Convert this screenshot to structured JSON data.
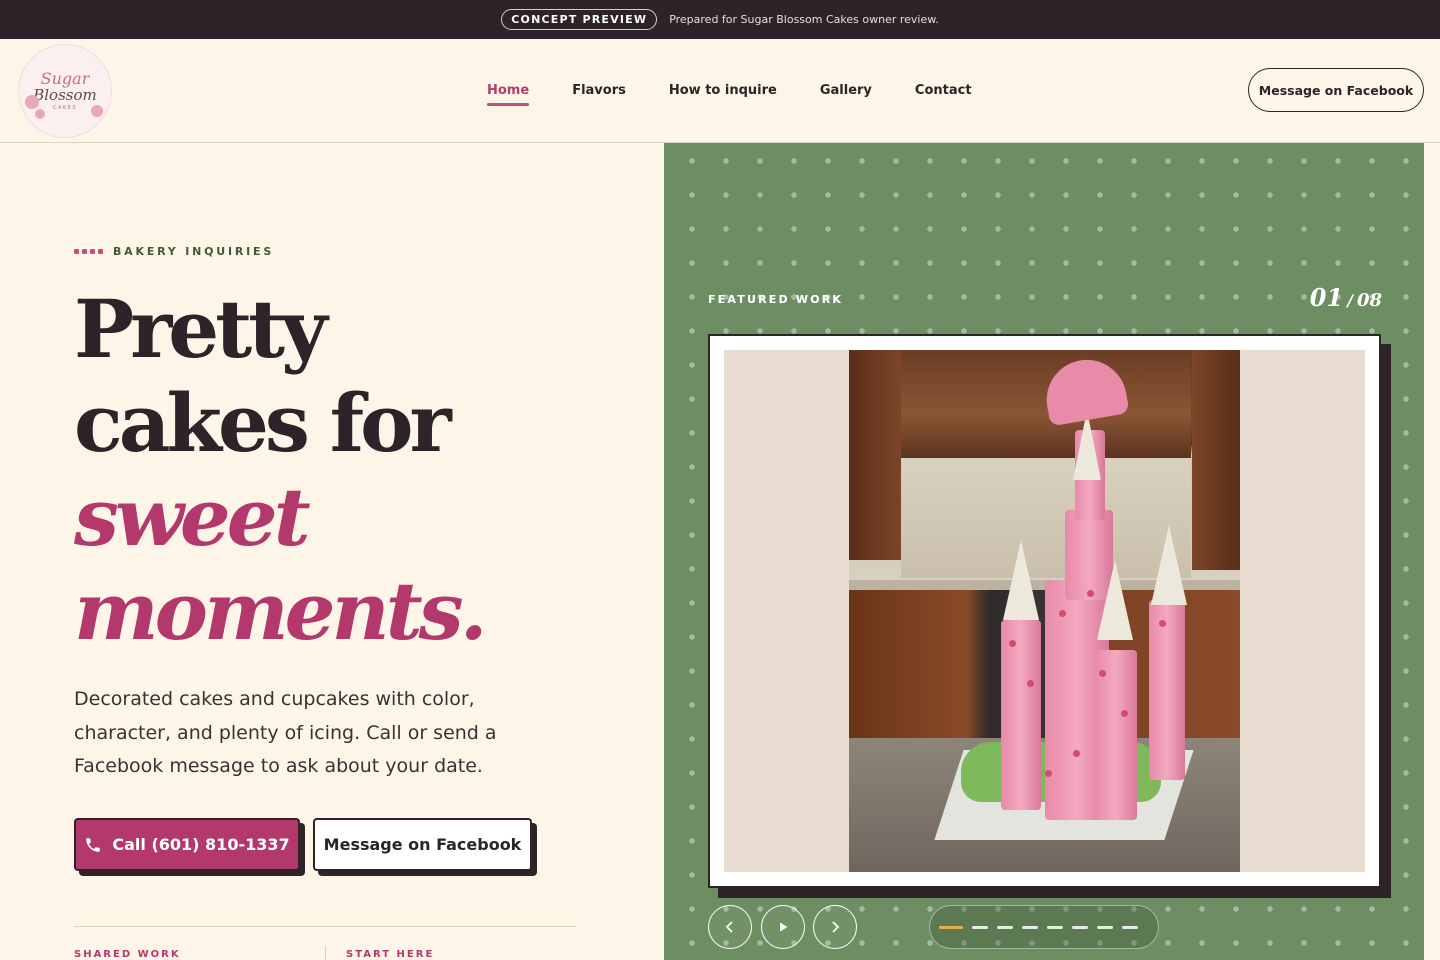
{
  "concept_bar": {
    "pill": "CONCEPT PREVIEW",
    "text": "Prepared for Sugar Blossom Cakes owner review."
  },
  "logo": {
    "line1": "Sugar",
    "line2": "Blossom",
    "line3": "CAKES"
  },
  "nav": {
    "items": [
      {
        "label": "Home",
        "active": true
      },
      {
        "label": "Flavors",
        "active": false
      },
      {
        "label": "How to inquire",
        "active": false
      },
      {
        "label": "Gallery",
        "active": false
      },
      {
        "label": "Contact",
        "active": false
      }
    ],
    "cta": "Message on Facebook"
  },
  "hero": {
    "eyebrow": "BAKERY INQUIRIES",
    "headline_line1": "Pretty",
    "headline_line2": "cakes for",
    "headline_line3": "sweet",
    "headline_line4": "moments.",
    "subcopy": "Decorated cakes and cupcakes with color, character, and plenty of icing. Call or send a Facebook message to ask about your date.",
    "call_button": "Call (601) 810-1337",
    "facebook_button": "Message on Facebook",
    "label_shared": "SHARED WORK",
    "label_start": "START HERE"
  },
  "featured": {
    "label": "FEATURED WORK",
    "current": "01",
    "separator": "/",
    "total": "08",
    "slide_count": 8,
    "active_slide": 1
  },
  "colors": {
    "accent": "#b3386b",
    "dark": "#2d2328",
    "panel_green": "#6d8d62",
    "cream": "#fdf6e8",
    "progress_active": "#e6b14a"
  },
  "icons": {
    "call": "phone-icon",
    "prev": "chevron-left-icon",
    "play": "play-icon",
    "next": "chevron-right-icon"
  }
}
